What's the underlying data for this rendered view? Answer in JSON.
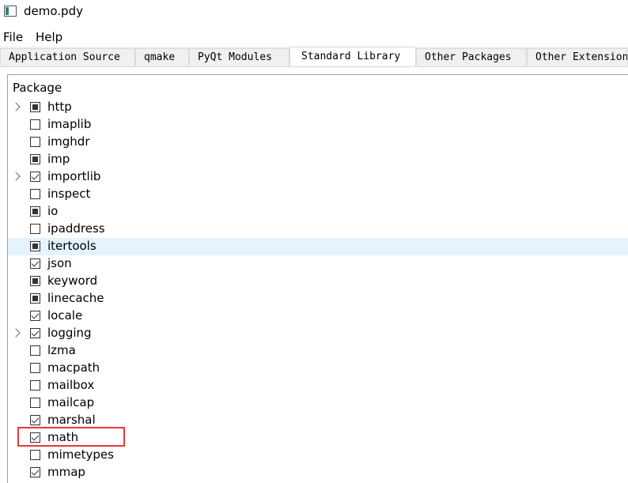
{
  "window": {
    "title": "demo.pdy"
  },
  "menu": {
    "file": "File",
    "help": "Help"
  },
  "tabs": [
    {
      "label": "Application Source"
    },
    {
      "label": "qmake"
    },
    {
      "label": "PyQt Modules"
    },
    {
      "label": "Standard Library"
    },
    {
      "label": "Other Packages"
    },
    {
      "label": "Other Extensions"
    }
  ],
  "tree": {
    "header": "Package",
    "items": [
      {
        "name": "http",
        "state": "partial",
        "expandable": true
      },
      {
        "name": "imaplib",
        "state": "unchecked",
        "expandable": false
      },
      {
        "name": "imghdr",
        "state": "unchecked",
        "expandable": false
      },
      {
        "name": "imp",
        "state": "partial",
        "expandable": false
      },
      {
        "name": "importlib",
        "state": "checked",
        "expandable": true
      },
      {
        "name": "inspect",
        "state": "unchecked",
        "expandable": false
      },
      {
        "name": "io",
        "state": "partial",
        "expandable": false
      },
      {
        "name": "ipaddress",
        "state": "unchecked",
        "expandable": false
      },
      {
        "name": "itertools",
        "state": "partial",
        "expandable": false,
        "highlighted": true
      },
      {
        "name": "json",
        "state": "checked",
        "expandable": false
      },
      {
        "name": "keyword",
        "state": "partial",
        "expandable": false
      },
      {
        "name": "linecache",
        "state": "partial",
        "expandable": false
      },
      {
        "name": "locale",
        "state": "checked",
        "expandable": false
      },
      {
        "name": "logging",
        "state": "checked",
        "expandable": true
      },
      {
        "name": "lzma",
        "state": "unchecked",
        "expandable": false
      },
      {
        "name": "macpath",
        "state": "unchecked",
        "expandable": false
      },
      {
        "name": "mailbox",
        "state": "unchecked",
        "expandable": false
      },
      {
        "name": "mailcap",
        "state": "unchecked",
        "expandable": false
      },
      {
        "name": "marshal",
        "state": "checked",
        "expandable": false
      },
      {
        "name": "math",
        "state": "checked",
        "expandable": false,
        "annotated": true
      },
      {
        "name": "mimetypes",
        "state": "unchecked",
        "expandable": false
      },
      {
        "name": "mmap",
        "state": "checked",
        "expandable": false
      }
    ]
  },
  "colors": {
    "annotation": "#e53935",
    "highlight": "#e5f3ff"
  }
}
